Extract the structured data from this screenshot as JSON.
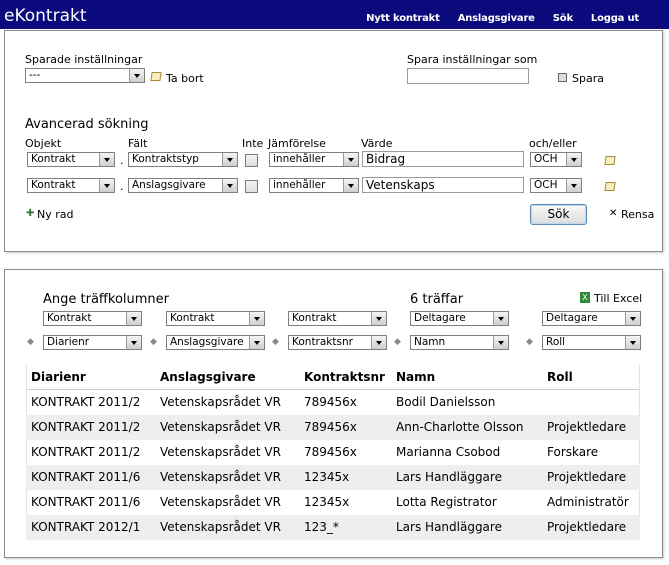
{
  "app": {
    "title": "eKontrakt"
  },
  "nav": [
    "Nytt kontrakt",
    "Anslagsgivare",
    "Sök",
    "Logga ut"
  ],
  "saved": {
    "label": "Sparade inställningar",
    "value": "---",
    "delete_label": "Ta bort",
    "save_as_label": "Spara inställningar som",
    "save_as_value": "",
    "save_label": "Spara"
  },
  "advanced": {
    "title": "Avancerad sökning",
    "headers": {
      "object": "Objekt",
      "field": "Fält",
      "not": "Inte",
      "comparison": "Jämförelse",
      "value": "Värde",
      "andor": "och/eller"
    },
    "rows": [
      {
        "object": "Kontrakt",
        "sep": ".",
        "field": "Kontraktstyp",
        "not": false,
        "comparison": "innehåller",
        "value": "Bidrag",
        "andor": "OCH"
      },
      {
        "object": "Kontrakt",
        "sep": ".",
        "field": "Anslagsgivare",
        "not": false,
        "comparison": "innehåller",
        "value": "Vetenskaps",
        "andor": "OCH"
      }
    ],
    "new_row_label": "Ny rad",
    "search_label": "Sök",
    "clear_label": "Rensa"
  },
  "results": {
    "columns_title": "Ange träffkolumner",
    "hits": "6 träffar",
    "export_label": "Till Excel",
    "selectors_top": [
      "Kontrakt",
      "Kontrakt",
      "Kontrakt",
      "Deltagare",
      "Deltagare"
    ],
    "selectors_bottom": [
      "Diarienr",
      "Anslagsgivare",
      "Kontraktsnr",
      "Namn",
      "Roll"
    ],
    "headers": [
      "Diarienr",
      "Anslagsgivare",
      "Kontraktsnr",
      "Namn",
      "Roll"
    ],
    "rows": [
      [
        "KONTRAKT 2011/2",
        "Vetenskapsrådet VR",
        "789456x",
        "Bodil Danielsson",
        ""
      ],
      [
        "KONTRAKT 2011/2",
        "Vetenskapsrådet VR",
        "789456x",
        "Ann-Charlotte Olsson",
        "Projektledare"
      ],
      [
        "KONTRAKT 2011/2",
        "Vetenskapsrådet VR",
        "789456x",
        "Marianna Csobod",
        "Forskare"
      ],
      [
        "KONTRAKT 2011/6",
        "Vetenskapsrådet VR",
        "12345x",
        "Lars Handläggare",
        "Projektledare"
      ],
      [
        "KONTRAKT 2011/6",
        "Vetenskapsrådet VR",
        "12345x",
        "Lotta Registrator",
        "Administratör"
      ],
      [
        "KONTRAKT 2012/1",
        "Vetenskapsrådet VR",
        "123_*",
        "Lars Handläggare",
        "Projektledare"
      ]
    ]
  }
}
